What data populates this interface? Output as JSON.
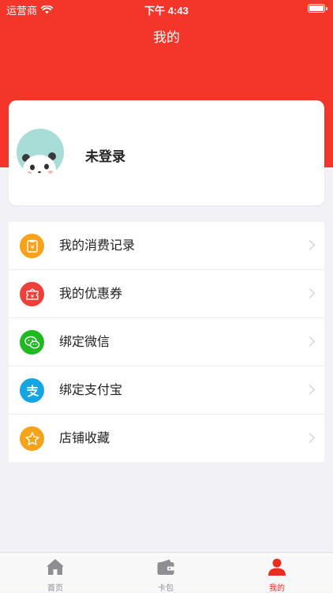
{
  "status_bar": {
    "carrier": "运营商",
    "time": "下午 4:43"
  },
  "nav": {
    "title": "我的"
  },
  "profile": {
    "login_text": "未登录"
  },
  "menu": {
    "items": [
      {
        "label": "我的消费记录",
        "icon": "receipt-icon",
        "color": "#f7a21b"
      },
      {
        "label": "我的优惠券",
        "icon": "coupon-icon",
        "color": "#ef3f3a"
      },
      {
        "label": "绑定微信",
        "icon": "wechat-icon",
        "color": "#1fb922"
      },
      {
        "label": "绑定支付宝",
        "icon": "alipay-icon",
        "color": "#14a5e4"
      },
      {
        "label": "店铺收藏",
        "icon": "star-icon",
        "color": "#f7a21b"
      }
    ]
  },
  "tabbar": {
    "items": [
      {
        "label": "首页",
        "icon": "home-icon"
      },
      {
        "label": "卡包",
        "icon": "wallet-icon"
      },
      {
        "label": "我的",
        "icon": "person-icon",
        "active": true
      }
    ]
  },
  "colors": {
    "brand": "#f4362a",
    "background": "#f2f2f6",
    "tab_active": "#e92d20",
    "tab_inactive": "#8e8e93"
  }
}
